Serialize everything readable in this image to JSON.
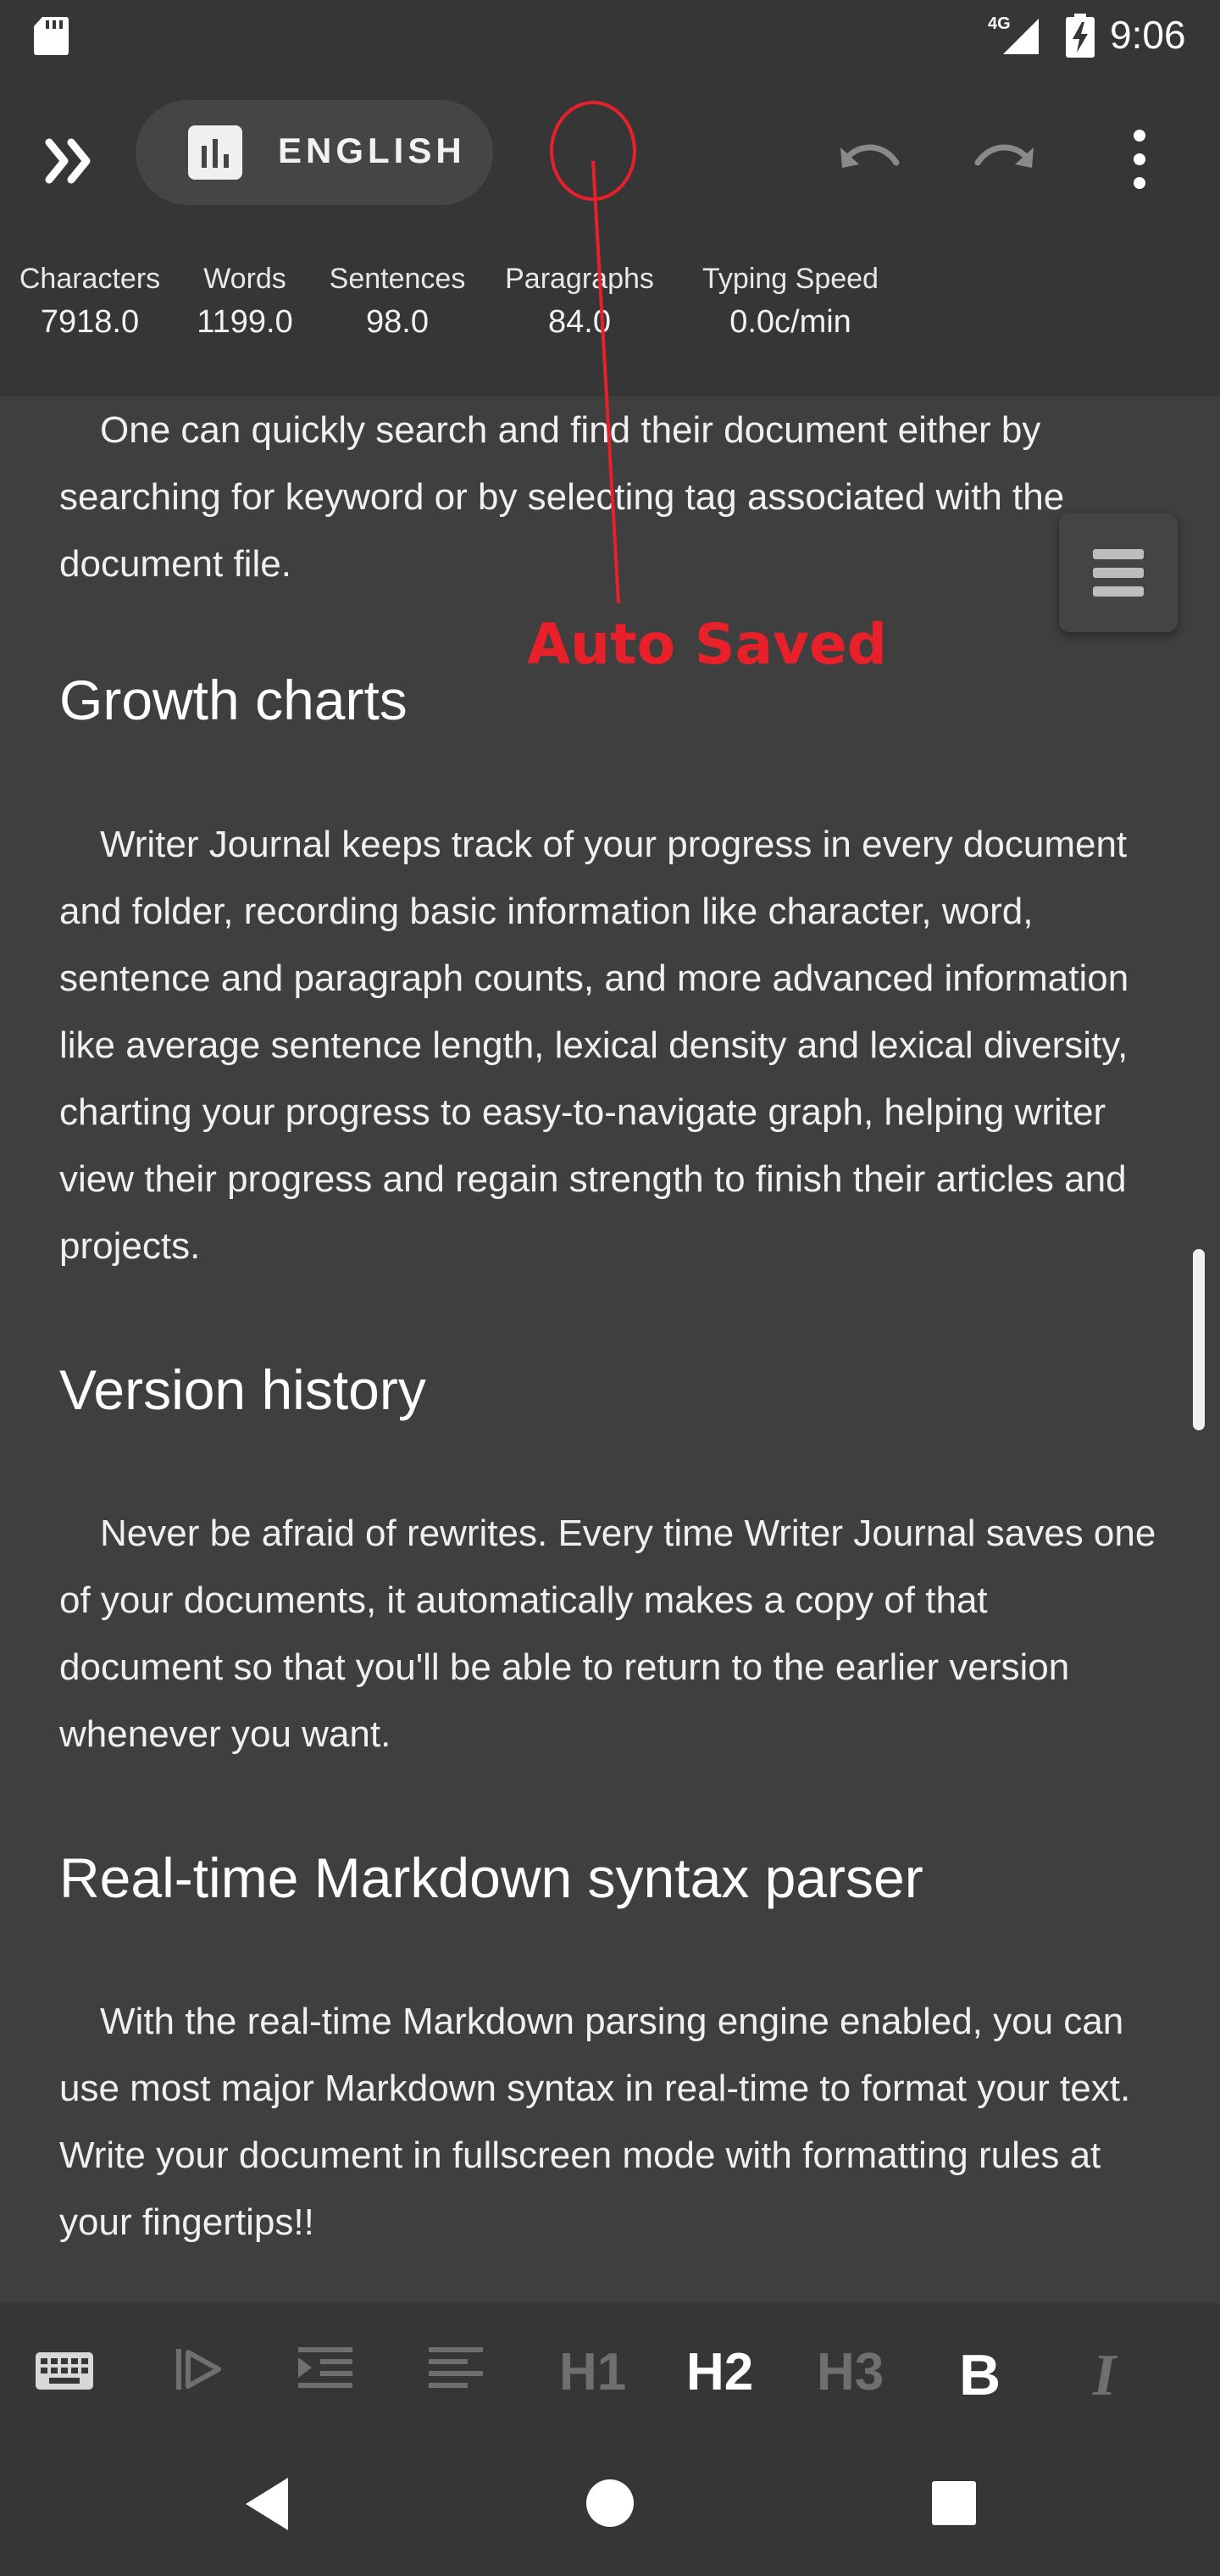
{
  "status_bar": {
    "time": "9:06",
    "network": "4G",
    "icons": [
      "sd-card-icon",
      "signal-icon",
      "battery-charging-icon"
    ]
  },
  "toolbar": {
    "language": "ENGLISH",
    "icons": [
      "expand-icon",
      "stats-icon",
      "undo-icon",
      "redo-icon",
      "more-vert-icon"
    ]
  },
  "stats": [
    {
      "label": "Characters",
      "value": "7918.0"
    },
    {
      "label": "Words",
      "value": "1199.0"
    },
    {
      "label": "Sentences",
      "value": "98.0"
    },
    {
      "label": "Paragraphs",
      "value": "84.0"
    },
    {
      "label": "Typing Speed",
      "value": "0.0c/min"
    }
  ],
  "document": {
    "intro_para": "One can quickly search and find their document either by searching for keyword or by selecting tag associated with the document file.",
    "sections": [
      {
        "heading": "Growth charts",
        "body": "Writer Journal keeps track of your progress in every document and folder, recording basic information like character, word, sentence and paragraph counts, and more advanced information like average sentence length, lexical density and lexical diversity, charting your progress to easy-to-navigate graph, helping writer view their progress and regain strength to finish their articles and projects."
      },
      {
        "heading": "Version history",
        "body": "Never be afraid of rewrites. Every time Writer Journal saves one of your documents, it automatically makes a copy of that document so that you'll be able to return to the earlier version whenever you want."
      },
      {
        "heading": "Real-time Markdown syntax parser",
        "body": "With the real-time Markdown parsing engine enabled, you can use most major Markdown syntax in real-time to format your text. Write your document in fullscreen mode with formatting rules at your fingertips!!"
      }
    ]
  },
  "annotation": {
    "text": "Auto Saved",
    "color": "#e8202a"
  },
  "format_bar": {
    "h1": "H1",
    "h2": "H2",
    "h3": "H3",
    "bold": "B",
    "italic": "I",
    "active": "H2",
    "icons": [
      "keyboard-icon",
      "outdent-icon",
      "indent-icon",
      "align-left-icon"
    ]
  },
  "nav_bar": {
    "icons": [
      "back-icon",
      "home-icon",
      "recents-icon"
    ]
  },
  "colors": {
    "background": "#3f3f3f",
    "bars": "#363636",
    "text": "#f0f0f0",
    "disabled": "#6f6f6f"
  }
}
